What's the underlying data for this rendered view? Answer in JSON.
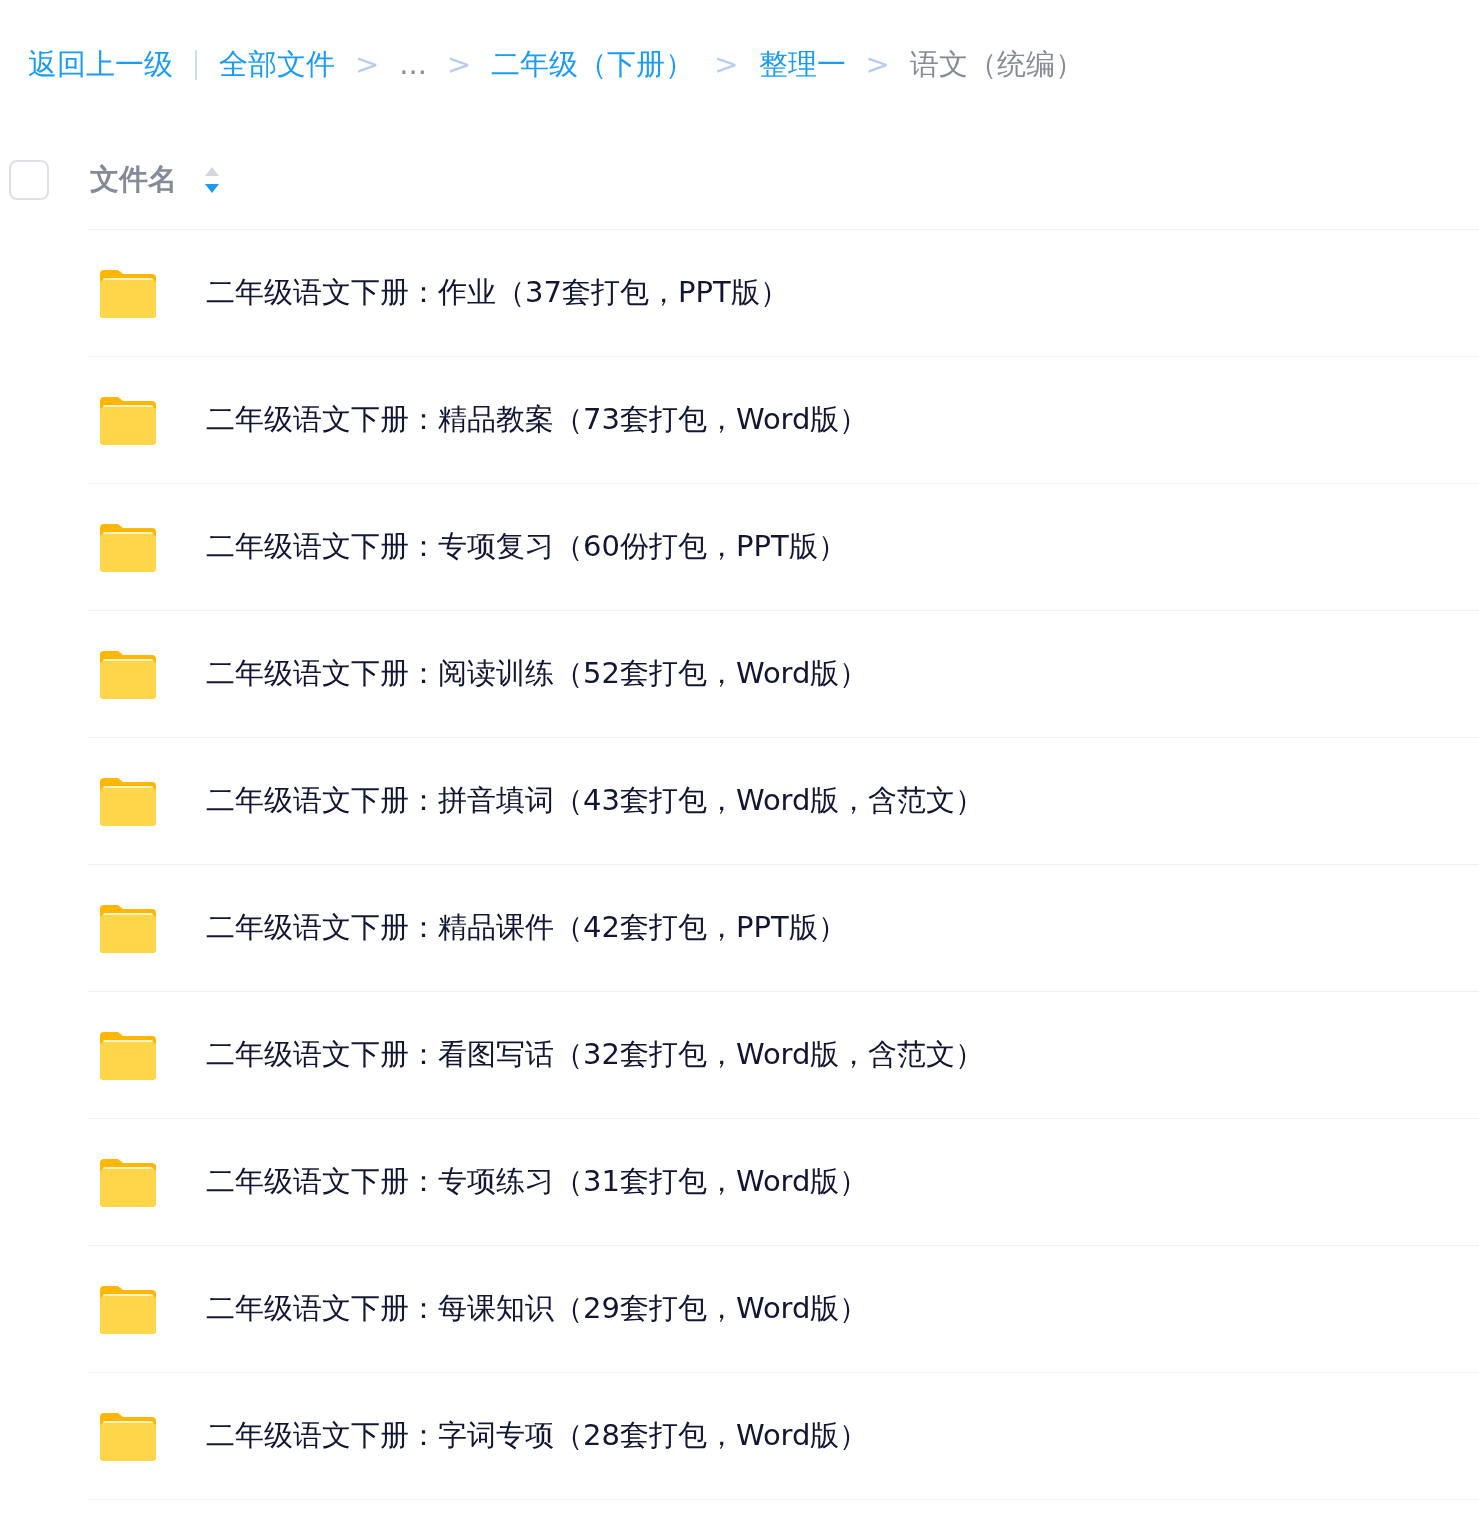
{
  "breadcrumb": {
    "back": "返回上一级",
    "items": [
      {
        "label": "全部文件",
        "kind": "link"
      },
      {
        "label": "...",
        "kind": "ellipsis"
      },
      {
        "label": "二年级（下册）",
        "kind": "link"
      },
      {
        "label": "整理一",
        "kind": "link"
      },
      {
        "label": "语文（统编）",
        "kind": "current"
      }
    ],
    "separator": ">"
  },
  "header": {
    "select_all": {
      "checked": false
    },
    "column": "文件名",
    "sort_descending": true
  },
  "files": [
    {
      "name": "二年级语文下册：作业（37套打包，PPT版）",
      "kind": "folder"
    },
    {
      "name": "二年级语文下册：精品教案（73套打包，Word版）",
      "kind": "folder"
    },
    {
      "name": "二年级语文下册：专项复习（60份打包，PPT版）",
      "kind": "folder"
    },
    {
      "name": "二年级语文下册：阅读训练（52套打包，Word版）",
      "kind": "folder"
    },
    {
      "name": "二年级语文下册：拼音填词（43套打包，Word版，含范文）",
      "kind": "folder"
    },
    {
      "name": "二年级语文下册：精品课件（42套打包，PPT版）",
      "kind": "folder"
    },
    {
      "name": "二年级语文下册：看图写话（32套打包，Word版，含范文）",
      "kind": "folder"
    },
    {
      "name": "二年级语文下册：专项练习（31套打包，Word版）",
      "kind": "folder"
    },
    {
      "name": "二年级语文下册：每课知识（29套打包，Word版）",
      "kind": "folder"
    },
    {
      "name": "二年级语文下册：字词专项（28套打包，Word版）",
      "kind": "folder"
    }
  ]
}
